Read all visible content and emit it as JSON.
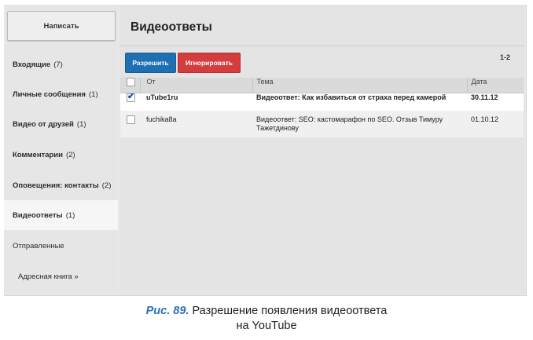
{
  "sidebar": {
    "compose_label": "Написать",
    "items": [
      {
        "label": "Входящие",
        "count": "(7)"
      },
      {
        "label": "Личные сообщения",
        "count": "(1)"
      },
      {
        "label": "Видео от друзей",
        "count": "(1)"
      },
      {
        "label": "Комментарии",
        "count": "(2)"
      },
      {
        "label": "Оповещения: контакты",
        "count": "(2)"
      },
      {
        "label": "Видеоответы",
        "count": "(1)"
      },
      {
        "label": "Отправленные",
        "count": ""
      },
      {
        "label": "Адресная книга »",
        "count": ""
      }
    ],
    "active_item": "Видеоответы"
  },
  "main": {
    "title": "Видеоответы",
    "allow_button": "Разрешить",
    "ignore_button": "Игнорировать",
    "range": "1-2",
    "columns": [
      "От",
      "Тема",
      "Дата"
    ],
    "rows": [
      {
        "from": "uTube1ru",
        "subject": "Видеоответ: Как избавиться от страха перед камерой",
        "date": "30.11.12",
        "checked": true
      },
      {
        "from": "fuchika8a",
        "subject": "Видеоответ: SEO: кастомарафон по SEO. Отзыв Тимуру Тажетдинову",
        "date": "01.10.12",
        "checked": false
      }
    ]
  },
  "caption": {
    "figure": "Рис. 89.",
    "line1": "Разрешение появления видеоответа",
    "line2": "на YouTube"
  },
  "colors": {
    "allow_button": "#1f6fb3",
    "ignore_button": "#d43d3d",
    "figure_label": "#2a6fb6"
  }
}
